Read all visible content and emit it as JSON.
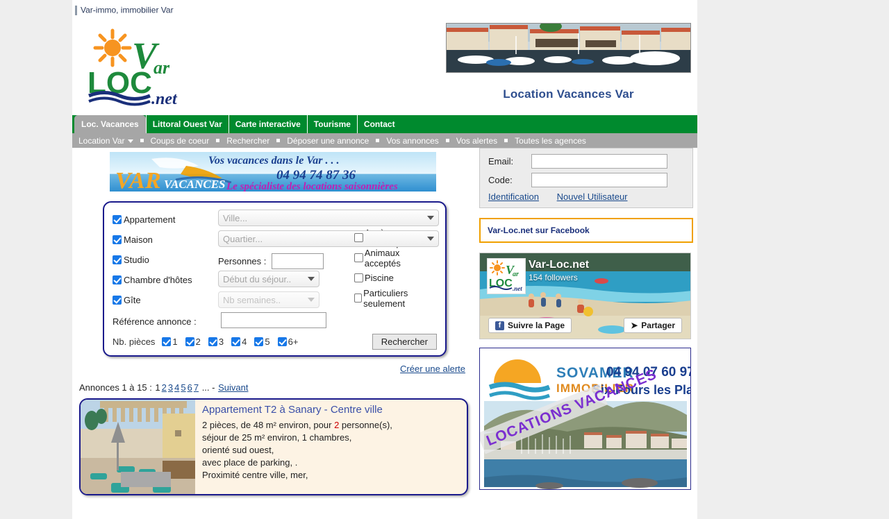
{
  "top": {
    "site_label": "Var-immo, immobilier Var"
  },
  "header": {
    "logo_alt": "Var-Loc.net",
    "logo_word1": "Var",
    "logo_word2": "LOC",
    "logo_word3": ".net",
    "hero_title": "Location Vacances Var"
  },
  "mainnav": {
    "items": [
      {
        "label": "Loc. Vacances",
        "active": true
      },
      {
        "label": "Littoral Ouest Var",
        "active": false
      },
      {
        "label": "Carte interactive",
        "active": false
      },
      {
        "label": "Tourisme",
        "active": false
      },
      {
        "label": "Contact",
        "active": false
      }
    ]
  },
  "subnav": {
    "items": [
      {
        "label": "Location Var",
        "caret": true
      },
      {
        "label": "Coups de coeur",
        "caret": false
      },
      {
        "label": "Rechercher",
        "caret": false
      },
      {
        "label": "Déposer une annonce",
        "caret": false
      },
      {
        "label": "Vos annonces",
        "caret": false
      },
      {
        "label": "Vos alertes",
        "caret": false
      },
      {
        "label": "Toutes les agences",
        "caret": false
      }
    ]
  },
  "banner": {
    "brand": "VAR",
    "brand_sub": "VACANCES",
    "tagline": "Vos vacances dans le Var . . .",
    "phone": "04 94 74 87 36",
    "subtitle": "Le spécialiste des locations saisonnières"
  },
  "search": {
    "types": [
      {
        "label": "Appartement",
        "checked": true
      },
      {
        "label": "Maison",
        "checked": true
      },
      {
        "label": "Studio",
        "checked": true
      },
      {
        "label": "Chambre d'hôtes",
        "checked": true
      },
      {
        "label": "Gîte",
        "checked": true
      }
    ],
    "city_placeholder": "Ville...",
    "district_placeholder": "Quartier...",
    "persons_label": "Personnes :",
    "persons_value": "",
    "start_placeholder": "Début du séjour..",
    "weeks_placeholder": "Nb semaines..",
    "reference_label": "Référence annonce :",
    "reference_value": "",
    "options": [
      {
        "label": "Accès handicapés",
        "checked": false
      },
      {
        "label": "Animaux acceptés",
        "checked": false
      },
      {
        "label": "Piscine",
        "checked": false
      },
      {
        "label": "Particuliers seulement",
        "checked": false
      }
    ],
    "rooms_label": "Nb. pièces",
    "rooms": [
      {
        "label": "1",
        "checked": true
      },
      {
        "label": "2",
        "checked": true
      },
      {
        "label": "3",
        "checked": true
      },
      {
        "label": "4",
        "checked": true
      },
      {
        "label": "5",
        "checked": true
      },
      {
        "label": "6+",
        "checked": true
      }
    ],
    "submit_label": "Rechercher",
    "alert_link": "Créer une alerte"
  },
  "pager": {
    "prefix": "Annonces 1 à 15 : ",
    "current": "1",
    "pages": [
      "2",
      "3",
      "4",
      "5",
      "6",
      "7"
    ],
    "ellipsis": "...",
    "dash": "-",
    "next": "Suivant"
  },
  "listing": {
    "title": "Appartement T2 à Sanary - Centre ville",
    "line1_a": "2 pièces, de 48 m² environ, pour ",
    "line1_num": "2",
    "line1_b": " personne(s),",
    "line2": "séjour de 25 m² environ, 1 chambres,",
    "line3": "orienté sud ouest,",
    "line4": "avec place de parking, .",
    "line5": "Proximité centre ville, mer,"
  },
  "login": {
    "email_label": "Email:",
    "email_value": "",
    "code_label": "Code:",
    "code_value": "",
    "link_identification": "Identification",
    "link_newuser": "Nouvel Utilisateur"
  },
  "facebook": {
    "header": "Var-Loc.net sur Facebook",
    "page_name": "Var-Loc.net",
    "followers": "154 followers",
    "follow_label": "Suivre la Page",
    "share_label": "Partager",
    "f_glyph": "f",
    "share_glyph": "➤"
  },
  "ad": {
    "brand_line1": "SOVAMER",
    "brand_line2": "IMMOBILIER",
    "phone": "04 94 07 60 97",
    "city": "Six-Fours les Plages",
    "ribbon": "LOCATIONS VACANCES"
  },
  "colors": {
    "nav_green": "#008a2e",
    "subnav_gray": "#a6a6a6",
    "link_blue": "#1a4a8c",
    "border_navy": "#1a1a8c",
    "accent_orange": "#f0a000",
    "listing_bg": "#fdf3e4"
  }
}
